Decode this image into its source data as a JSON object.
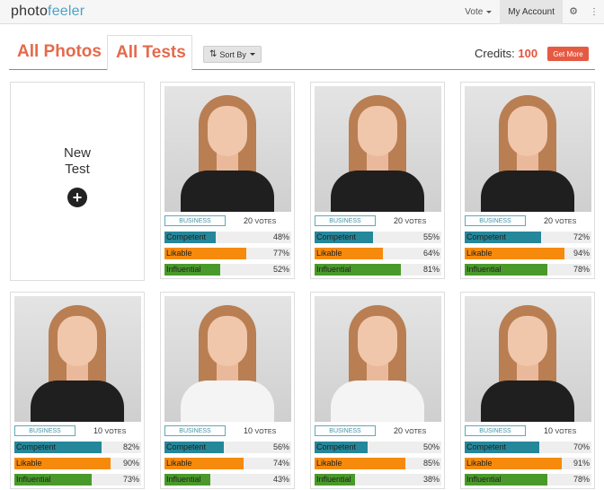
{
  "navbar": {
    "logo_part1": "photo",
    "logo_part2": "feeler",
    "vote_label": "Vote",
    "account_label": "My Account",
    "settings_icon": "gear-icon",
    "more_icon": "vertical-dots-icon"
  },
  "tabs": {
    "all_photos": "All Photos",
    "all_tests": "All Tests",
    "sort_label": "Sort By"
  },
  "credits": {
    "label": "Credits:",
    "value": "100",
    "get_more": "Get More"
  },
  "new_test": {
    "line1": "New",
    "line2": "Test",
    "icon": "plus-circle-icon"
  },
  "tests": [
    {
      "category": "BUSINESS",
      "votes": "20",
      "votes_unit": "VOTES",
      "outfit": "black",
      "competent": 48,
      "likable": 77,
      "influential": 52,
      "competent_label": "48%",
      "likable_label": "77%",
      "influential_label": "52%"
    },
    {
      "category": "BUSINESS",
      "votes": "20",
      "votes_unit": "VOTES",
      "outfit": "black",
      "competent": 55,
      "likable": 64,
      "influential": 81,
      "competent_label": "55%",
      "likable_label": "64%",
      "influential_label": "81%"
    },
    {
      "category": "BUSINESS",
      "votes": "20",
      "votes_unit": "VOTES",
      "outfit": "black",
      "competent": 72,
      "likable": 94,
      "influential": 78,
      "competent_label": "72%",
      "likable_label": "94%",
      "influential_label": "78%"
    },
    {
      "category": "BUSINESS",
      "votes": "10",
      "votes_unit": "VOTES",
      "outfit": "black",
      "competent": 82,
      "likable": 90,
      "influential": 73,
      "competent_label": "82%",
      "likable_label": "90%",
      "influential_label": "73%"
    },
    {
      "category": "BUSINESS",
      "votes": "10",
      "votes_unit": "VOTES",
      "outfit": "white",
      "competent": 56,
      "likable": 74,
      "influential": 43,
      "competent_label": "56%",
      "likable_label": "74%",
      "influential_label": "43%"
    },
    {
      "category": "BUSINESS",
      "votes": "20",
      "votes_unit": "VOTES",
      "outfit": "white",
      "competent": 50,
      "likable": 85,
      "influential": 38,
      "competent_label": "50%",
      "likable_label": "85%",
      "influential_label": "38%"
    },
    {
      "category": "BUSINESS",
      "votes": "10",
      "votes_unit": "VOTES",
      "outfit": "black",
      "competent": 70,
      "likable": 91,
      "influential": 78,
      "competent_label": "70%",
      "likable_label": "91%",
      "influential_label": "78%"
    }
  ],
  "trait_labels": {
    "competent": "Competent",
    "likable": "Likable",
    "influential": "Influential"
  },
  "colors": {
    "accent": "#e56a4b",
    "competent": "#25879a",
    "likable": "#f58a0c",
    "influential": "#4a9a2b"
  }
}
